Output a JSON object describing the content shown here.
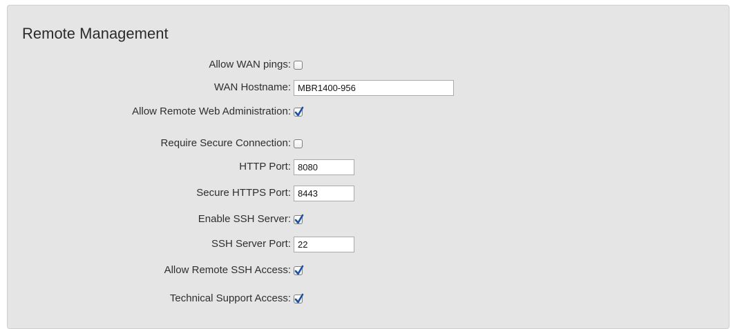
{
  "section": {
    "title": "Remote Management"
  },
  "fields": {
    "allow_wan_pings": {
      "label": "Allow WAN pings:",
      "checked": false
    },
    "wan_hostname": {
      "label": "WAN Hostname:",
      "value": "MBR1400-956"
    },
    "allow_remote_web_admin": {
      "label": "Allow Remote Web Administration:",
      "checked": true
    },
    "require_secure_connection": {
      "label": "Require Secure Connection:",
      "checked": false
    },
    "http_port": {
      "label": "HTTP Port:",
      "value": "8080"
    },
    "secure_https_port": {
      "label": "Secure HTTPS Port:",
      "value": "8443"
    },
    "enable_ssh_server": {
      "label": "Enable SSH Server:",
      "checked": true
    },
    "ssh_server_port": {
      "label": "SSH Server Port:",
      "value": "22"
    },
    "allow_remote_ssh_access": {
      "label": "Allow Remote SSH Access:",
      "checked": true
    },
    "technical_support_access": {
      "label": "Technical Support Access:",
      "checked": true
    }
  },
  "colors": {
    "panel_background": "#e5e5e5",
    "checkmark": "#1f4fa0"
  }
}
